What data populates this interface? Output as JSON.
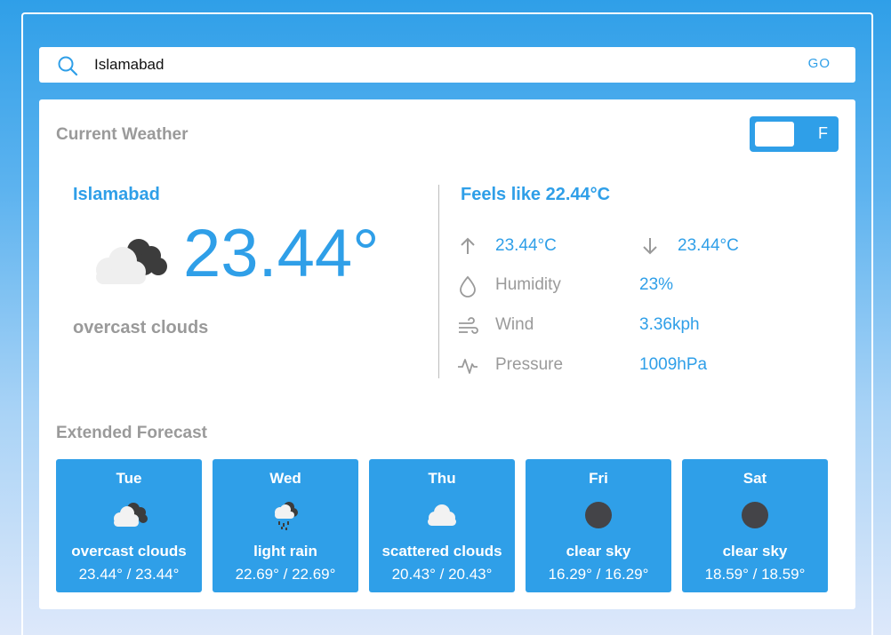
{
  "search": {
    "value": "Islamabad",
    "go_label": "GO"
  },
  "current": {
    "section_title": "Current Weather",
    "unit_toggle_label": "F",
    "city": "Islamabad",
    "temperature": "23.44°",
    "description": "overcast clouds",
    "feels_like": "Feels like 22.44°C",
    "max_temp": "23.44°C",
    "min_temp": "23.44°C",
    "humidity_label": "Humidity",
    "humidity_value": "23%",
    "wind_label": "Wind",
    "wind_value": "3.36kph",
    "pressure_label": "Pressure",
    "pressure_value": "1009hPa",
    "icon": "overcast-clouds-icon"
  },
  "forecast": {
    "section_title": "Extended Forecast",
    "days": [
      {
        "day": "Tue",
        "description": "overcast clouds",
        "temps": "23.44° / 23.44°",
        "icon": "overcast-clouds-icon"
      },
      {
        "day": "Wed",
        "description": "light rain",
        "temps": "22.69° / 22.69°",
        "icon": "light-rain-icon"
      },
      {
        "day": "Thu",
        "description": "scattered clouds",
        "temps": "20.43° / 20.43°",
        "icon": "scattered-clouds-icon"
      },
      {
        "day": "Fri",
        "description": "clear sky",
        "temps": "16.29° / 16.29°",
        "icon": "clear-sky-night-icon"
      },
      {
        "day": "Sat",
        "description": "clear sky",
        "temps": "18.59° / 18.59°",
        "icon": "clear-sky-night-icon"
      }
    ]
  },
  "colors": {
    "accent": "#2f9fe8",
    "muted_text": "#9a9a9a",
    "card_bg": "#ffffff"
  }
}
